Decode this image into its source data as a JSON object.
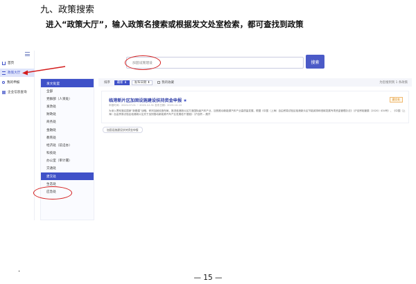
{
  "document": {
    "heading": "九、政策搜索",
    "intro": "进入“政策大厅”，输入政策名搜索或根据发文处室检索，都可查找到政策",
    "page_number": "— 15 —",
    "stray_mark": "."
  },
  "nav": {
    "items": [
      {
        "label": "首页"
      },
      {
        "label": "政策大厅",
        "active": true
      },
      {
        "label": "我的申报"
      },
      {
        "label": "企业信息查询"
      }
    ]
  },
  "search": {
    "value": "加固设施建设",
    "button_label": "搜索"
  },
  "offices": {
    "header": "发文处室",
    "items": [
      "全部",
      "党群部（人资处）",
      "发改处",
      "财政处",
      "商务处",
      "金融处",
      "教育处",
      "经济处（前沿办）",
      "科技处",
      "办公室（审计署）",
      "交通处",
      "建交处",
      "生态处",
      "应急处"
    ],
    "active_index": 11
  },
  "results": {
    "sort_label": "排序",
    "sort_primary": "最新 ⬇",
    "sort_secondary": "发布日期 ⬇",
    "favorite_label": "我的收藏",
    "count_text": "为您搜到到 1 条政策"
  },
  "policy": {
    "title": "临港新片区加固设施建设扶持资金申报",
    "star": "★",
    "meta": "申报时间：2023-07-01 ~ 2023-12-31  发布日期：2023-10-10",
    "summary": "为深入贯彻落实国家“新基建”战略，研判加固设施布局，推进临港新片区打造国际级汽车产业，加快推动新能源汽车产业高质量发展，根据《中国（上海）自由贸易试验区临港新片区节能减排和低碳发展专项资金管理办法》（沪自贸临管委〔2020〕434号）、《中国（上海）自由贸易试验区临港新片区关于加快推动新能源汽车产业发展若干措施》（沪自贸...  展开",
    "tag": "建交处",
    "apply_button": "加固设施建设扶持资金申报"
  }
}
